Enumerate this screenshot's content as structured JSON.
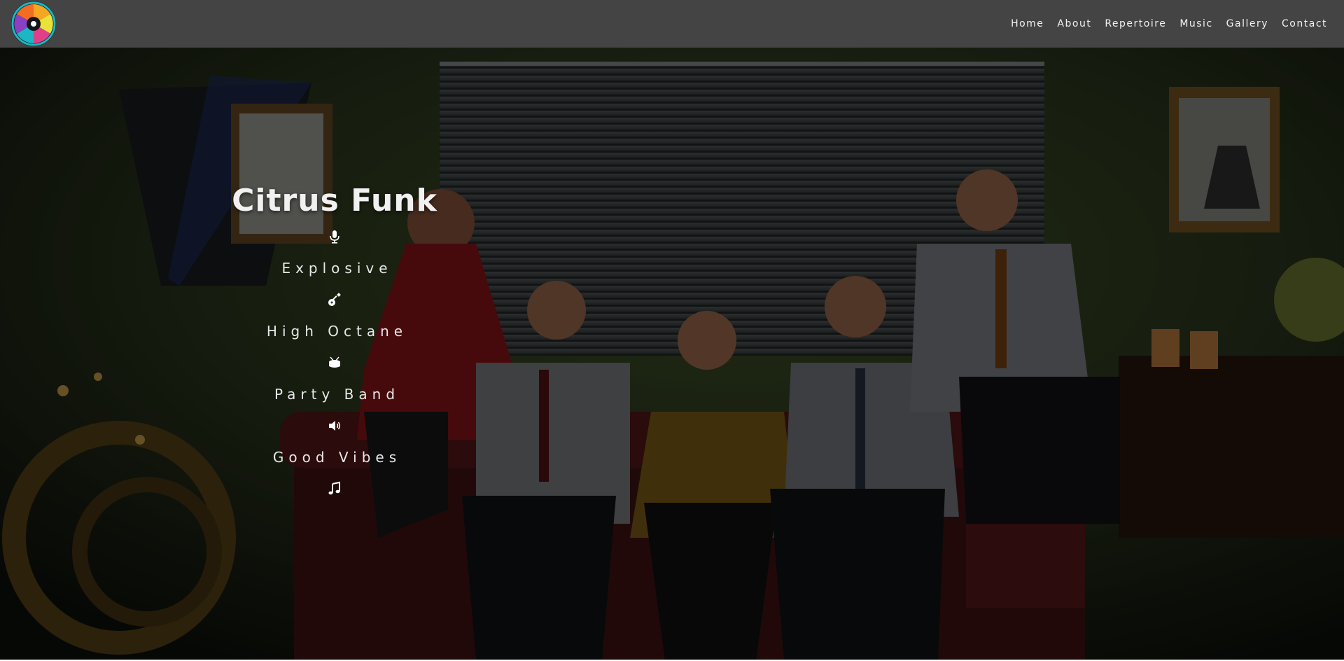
{
  "site": {
    "logo_icon": "citrus-funk-logo",
    "nav": [
      "Home",
      "About",
      "Repertoire",
      "Music",
      "Gallery",
      "Contact"
    ]
  },
  "hero": {
    "title": "Citrus Funk",
    "taglines": [
      "Explosive",
      "High Octane",
      "Party Band",
      "Good Vibes"
    ],
    "icons": [
      "microphone-icon",
      "guitar-icon",
      "drum-icon",
      "speaker-icon",
      "music-note-icon"
    ]
  },
  "colors": {
    "header_bg": "#444444",
    "text": "#ffffff"
  }
}
